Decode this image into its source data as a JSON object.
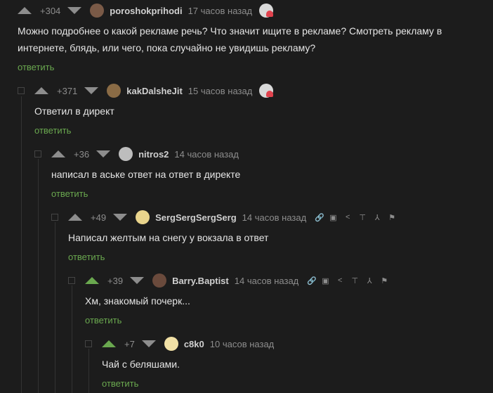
{
  "comments": [
    {
      "rating": "+304",
      "username": "poroshokprihodi",
      "time": "17 часов назад",
      "text": "Можно подробнее о какой рекламе речь? Что значит ищите в рекламе? Смотреть рекламу в интернете, блядь, или чего, пока случайно не увидишь рекламу?",
      "reply": "ответить",
      "avatar_color": "#7a5a47"
    },
    {
      "rating": "+371",
      "username": "kakDalsheJit",
      "time": "15 часов назад",
      "text": "Ответил в директ",
      "reply": "ответить",
      "avatar_color": "#8a6b45"
    },
    {
      "rating": "+36",
      "username": "nitros2",
      "time": "14 часов назад",
      "text": "написал в аське ответ на ответ в директе",
      "reply": "ответить",
      "avatar_color": "#bdbdbd"
    },
    {
      "rating": "+49",
      "username": "SergSergSergSerg",
      "time": "14 часов назад",
      "text": "Написал желтым на снегу у вокзала в ответ",
      "reply": "ответить",
      "avatar_color": "#e9d48c"
    },
    {
      "rating": "+39",
      "username": "Barry.Baptist",
      "time": "14 часов назад",
      "text": "Хм, знакомый почерк...",
      "reply": "ответить",
      "avatar_color": "#6a4a3c"
    },
    {
      "rating": "+7",
      "username": "c8k0",
      "time": "10 часов назад",
      "text": "Чай с беляшами.",
      "reply": "ответить",
      "avatar_color": "#f1e0a5"
    }
  ],
  "icons": {
    "link": "link-icon",
    "save": "save-icon",
    "share": "share-icon",
    "up": "jump-up-icon",
    "branch": "branch-icon",
    "report": "flag-icon"
  },
  "colors": {
    "background": "#1c1c1c",
    "accent": "#6aa84f",
    "muted": "#8d8d8d"
  }
}
